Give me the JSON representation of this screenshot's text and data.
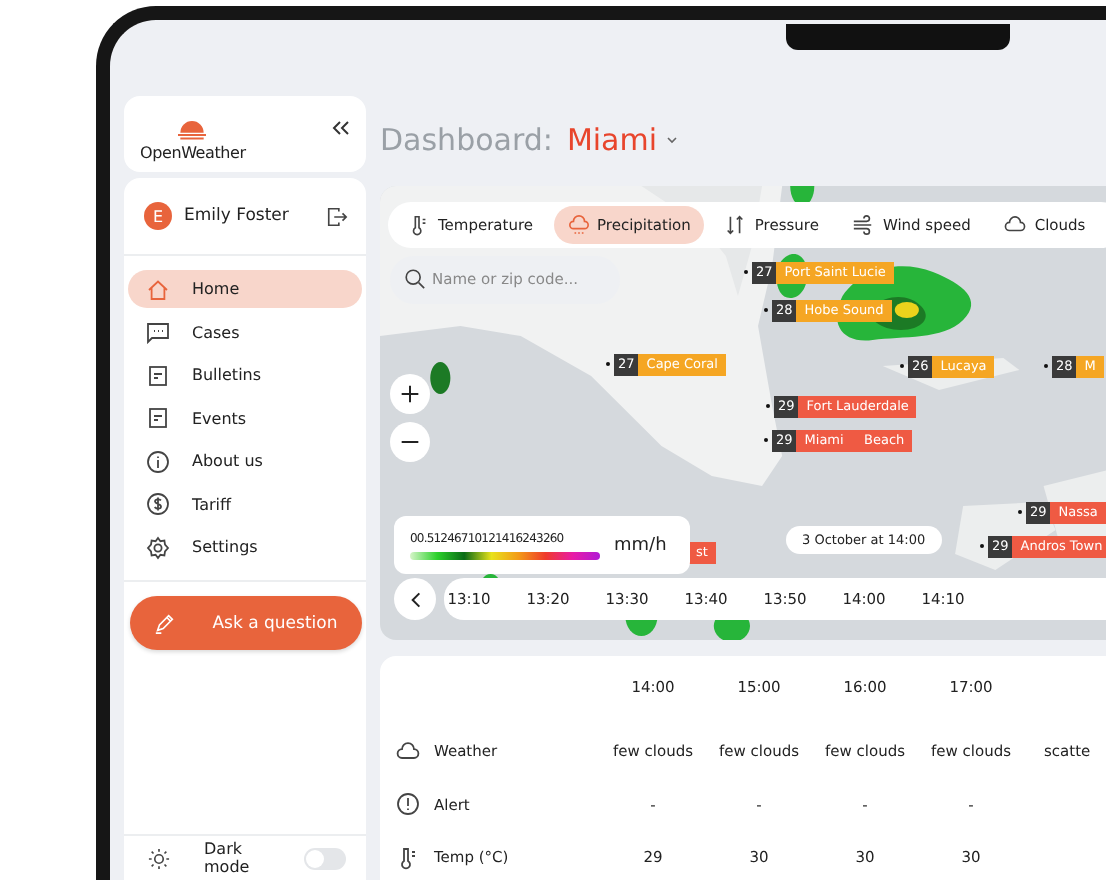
{
  "sidebar": {
    "logo": "OpenWeather",
    "user": {
      "initial": "E",
      "name": "Emily Foster"
    },
    "nav": [
      {
        "label": "Home",
        "selected": true
      },
      {
        "label": "Cases",
        "selected": false
      },
      {
        "label": "Bulletins",
        "selected": false
      },
      {
        "label": "Events",
        "selected": false
      },
      {
        "label": "About us",
        "selected": false
      },
      {
        "label": "Tariff",
        "selected": false
      },
      {
        "label": "Settings",
        "selected": false
      }
    ],
    "ask_button": "Ask a question",
    "dark_mode": {
      "label": "Dark mode",
      "on": false
    }
  },
  "header": {
    "title": "Dashboard:",
    "city": "Miami"
  },
  "map": {
    "tabs": [
      {
        "label": "Temperature",
        "selected": false
      },
      {
        "label": "Precipitation",
        "selected": true
      },
      {
        "label": "Pressure",
        "selected": false
      },
      {
        "label": "Wind speed",
        "selected": false
      },
      {
        "label": "Clouds",
        "selected": false
      }
    ],
    "search": {
      "placeholder": "Name or zip code..."
    },
    "markers": [
      {
        "temp": "27",
        "name": "Port Saint Lucie",
        "color": "#f5a623"
      },
      {
        "temp": "28",
        "name": "Hobe Sound",
        "color": "#f5a623"
      },
      {
        "temp": "27",
        "name": "Cape Coral",
        "color": "#f5a623"
      },
      {
        "temp": "26",
        "name": "Lucaya",
        "color": "#f5a623"
      },
      {
        "temp": "28",
        "name": "M",
        "color": "#f5a623"
      },
      {
        "temp": "29",
        "name": "Fort Lauderdale",
        "color": "#ef5a43"
      },
      {
        "name": "Beach",
        "color": "#ef5a43"
      },
      {
        "temp": "29",
        "name": "Miami",
        "color": "#ef5a43"
      },
      {
        "temp": "29",
        "name": "Nassa",
        "color": "#ef5a43"
      },
      {
        "temp": "29",
        "name": "Andros Town",
        "color": "#ef5a43"
      },
      {
        "name": "st",
        "color": "#ef5a43"
      }
    ],
    "legend": {
      "scale": "00.51246710121416243260",
      "unit": "mm/h"
    },
    "date": "3 October at 14:00",
    "timeline": [
      "13:10",
      "13:20",
      "13:30",
      "13:40",
      "13:50",
      "14:00",
      "14:10"
    ]
  },
  "forecast": {
    "columns": [
      "14:00",
      "15:00",
      "16:00",
      "17:00"
    ],
    "rows": [
      {
        "label": "Weather",
        "cells": [
          "few clouds",
          "few clouds",
          "few clouds",
          "few clouds",
          "scatte"
        ]
      },
      {
        "label": "Alert",
        "cells": [
          "-",
          "-",
          "-",
          "-"
        ]
      },
      {
        "label": "Temp (°C)",
        "cells": [
          "29",
          "30",
          "30",
          "30"
        ]
      }
    ]
  }
}
